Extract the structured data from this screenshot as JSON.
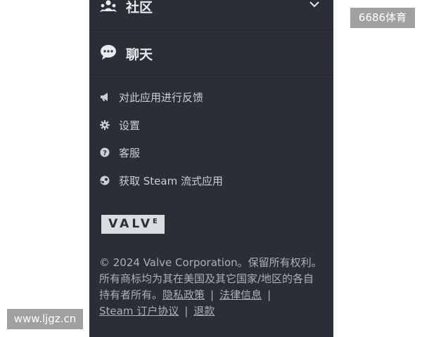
{
  "menu": {
    "community": {
      "label": "社区",
      "icon": "community-icon",
      "expand_icon": "chevron-down-icon"
    },
    "chat": {
      "label": "聊天",
      "icon": "chat-bubble-icon"
    },
    "items": [
      {
        "label": "对此应用进行反馈",
        "icon": "megaphone-icon"
      },
      {
        "label": "设置",
        "icon": "gear-icon"
      },
      {
        "label": "客服",
        "icon": "help-circle-icon"
      },
      {
        "label": "获取 Steam 流式应用",
        "icon": "steam-logo-icon"
      }
    ]
  },
  "logo": {
    "text": "VALV",
    "superscript": "E"
  },
  "footer": {
    "copyright": "© 2024 Valve Corporation。保留所有权利。所有商标均为其在美国及其它国家/地区的各自持有者所有。",
    "links": {
      "privacy": "隐私政策",
      "legal": "法律信息",
      "subscriber_agreement": "Steam 订户协议",
      "refunds": "退款"
    },
    "separator": "|"
  },
  "watermarks": {
    "top_right": "6686体育",
    "bottom_left": "www.ljgz.cn"
  },
  "colors": {
    "panel_bg": "#2b2f35",
    "text": "#c7d0d9",
    "footer_text": "#a8b2bc"
  }
}
